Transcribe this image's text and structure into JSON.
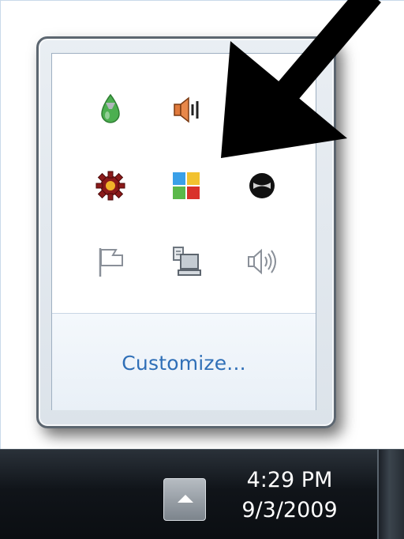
{
  "notification_overflow": {
    "icons": [
      {
        "name": "green-droplet-app-icon",
        "row": 1,
        "col": 1
      },
      {
        "name": "muted-speaker-icon",
        "row": 1,
        "col": 2
      },
      {
        "name": "red-gear-app-icon",
        "row": 2,
        "col": 1
      },
      {
        "name": "windows-flag-app-icon",
        "row": 2,
        "col": 2
      },
      {
        "name": "black-circle-app-icon",
        "row": 2,
        "col": 3
      },
      {
        "name": "action-center-flag-icon",
        "row": 3,
        "col": 1
      },
      {
        "name": "network-computer-icon",
        "row": 3,
        "col": 2
      },
      {
        "name": "volume-speaker-icon",
        "row": 3,
        "col": 3
      }
    ],
    "customize_label": "Customize..."
  },
  "taskbar": {
    "clock": {
      "time": "4:29 PM",
      "date": "9/3/2009"
    }
  },
  "colors": {
    "link": "#2f6fb7",
    "taskbar": "#101419",
    "flyout_border": "#5c6670"
  }
}
